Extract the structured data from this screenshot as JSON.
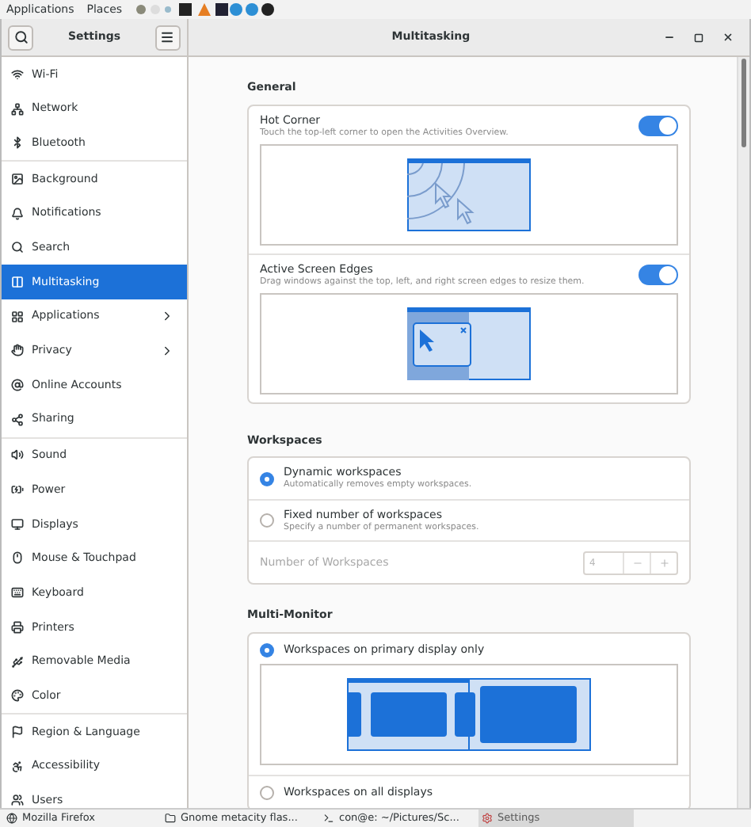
{
  "top_panel": {
    "menus": [
      "Applications",
      "Places"
    ]
  },
  "sidebar": {
    "title": "Settings",
    "groups": [
      {
        "items": [
          {
            "label": "Wi-Fi",
            "selected": false,
            "submenu": false
          },
          {
            "label": "Network",
            "selected": false,
            "submenu": false
          },
          {
            "label": "Bluetooth",
            "selected": false,
            "submenu": false
          }
        ]
      },
      {
        "items": [
          {
            "label": "Background",
            "selected": false,
            "submenu": false
          },
          {
            "label": "Notifications",
            "selected": false,
            "submenu": false
          },
          {
            "label": "Search",
            "selected": false,
            "submenu": false
          },
          {
            "label": "Multitasking",
            "selected": true,
            "submenu": false
          },
          {
            "label": "Applications",
            "selected": false,
            "submenu": true
          },
          {
            "label": "Privacy",
            "selected": false,
            "submenu": true
          },
          {
            "label": "Online Accounts",
            "selected": false,
            "submenu": false
          },
          {
            "label": "Sharing",
            "selected": false,
            "submenu": false
          }
        ]
      },
      {
        "items": [
          {
            "label": "Sound",
            "selected": false,
            "submenu": false
          },
          {
            "label": "Power",
            "selected": false,
            "submenu": false
          },
          {
            "label": "Displays",
            "selected": false,
            "submenu": false
          },
          {
            "label": "Mouse & Touchpad",
            "selected": false,
            "submenu": false
          },
          {
            "label": "Keyboard",
            "selected": false,
            "submenu": false
          },
          {
            "label": "Printers",
            "selected": false,
            "submenu": false
          },
          {
            "label": "Removable Media",
            "selected": false,
            "submenu": false
          },
          {
            "label": "Color",
            "selected": false,
            "submenu": false
          }
        ]
      },
      {
        "items": [
          {
            "label": "Region & Language",
            "selected": false,
            "submenu": false
          },
          {
            "label": "Accessibility",
            "selected": false,
            "submenu": false
          },
          {
            "label": "Users",
            "selected": false,
            "submenu": false
          }
        ]
      }
    ]
  },
  "content": {
    "title": "Multitasking",
    "general": {
      "heading": "General",
      "rows": [
        {
          "title": "Hot Corner",
          "subtitle": "Touch the top-left corner to open the Activities Overview.",
          "on": true
        },
        {
          "title": "Active Screen Edges",
          "subtitle": "Drag windows against the top, left, and right screen edges to resize them.",
          "on": true
        }
      ]
    },
    "workspaces": {
      "heading": "Workspaces",
      "options": [
        {
          "title": "Dynamic workspaces",
          "subtitle": "Automatically removes empty workspaces.",
          "selected": true
        },
        {
          "title": "Fixed number of workspaces",
          "subtitle": "Specify a number of permanent workspaces.",
          "selected": false
        }
      ],
      "number_row": {
        "label": "Number of Workspaces",
        "value": "4",
        "disabled": true
      }
    },
    "multi_monitor": {
      "heading": "Multi-Monitor",
      "options": [
        {
          "title": "Workspaces on primary display only",
          "selected": true
        },
        {
          "title": "Workspaces on all displays",
          "selected": false
        }
      ]
    }
  },
  "taskbar": {
    "items": [
      {
        "label": "Mozilla Firefox",
        "selected": false
      },
      {
        "label": "Gnome metacity flas...",
        "selected": false
      },
      {
        "label": "con@e: ~/Pictures/Sc...",
        "selected": false
      },
      {
        "label": "Settings",
        "selected": true
      }
    ]
  }
}
